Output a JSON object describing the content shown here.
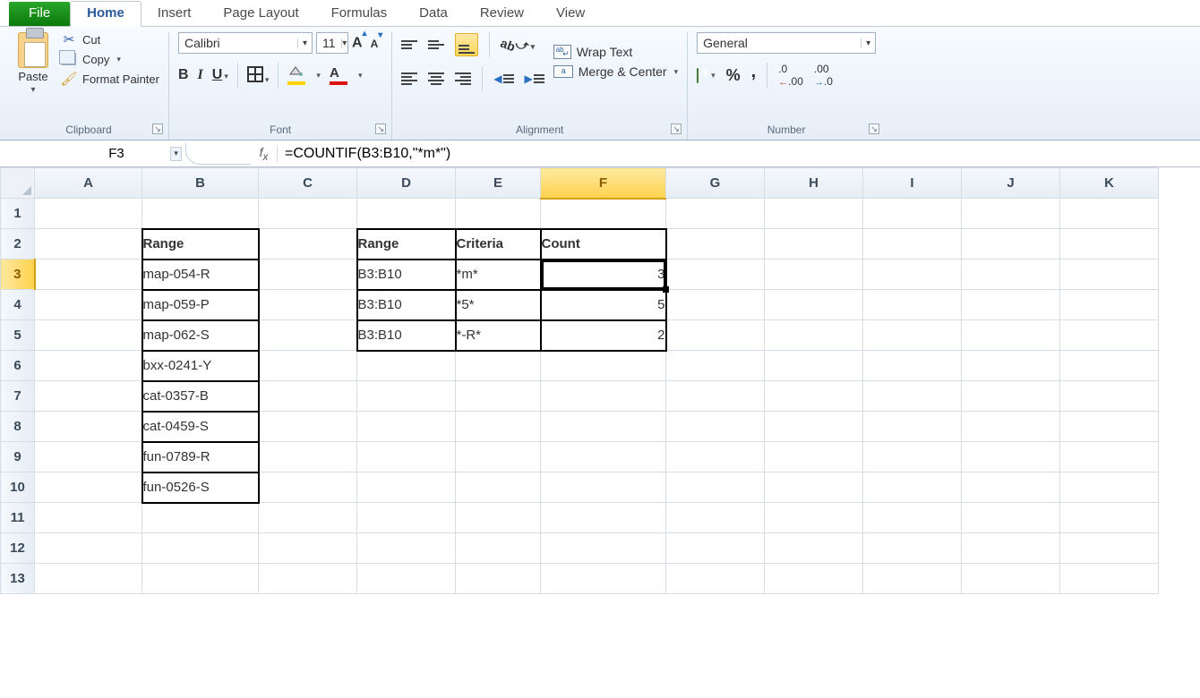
{
  "tabs": {
    "file": "File",
    "home": "Home",
    "insert": "Insert",
    "page_layout": "Page Layout",
    "formulas": "Formulas",
    "data": "Data",
    "review": "Review",
    "view": "View"
  },
  "ribbon": {
    "clipboard": {
      "label": "Clipboard",
      "paste": "Paste",
      "cut": "Cut",
      "copy": "Copy",
      "format_painter": "Format Painter"
    },
    "font": {
      "label": "Font",
      "name": "Calibri",
      "size": "11"
    },
    "alignment": {
      "label": "Alignment",
      "wrap": "Wrap Text",
      "merge": "Merge & Center"
    },
    "number": {
      "label": "Number",
      "format": "General"
    }
  },
  "formula_bar": {
    "namebox": "F3",
    "formula": "=COUNTIF(B3:B10,\"*m*\")"
  },
  "columns": [
    "A",
    "B",
    "C",
    "D",
    "E",
    "F",
    "G",
    "H",
    "I",
    "J",
    "K"
  ],
  "rows": [
    "1",
    "2",
    "3",
    "4",
    "5",
    "6",
    "7",
    "8",
    "9",
    "10",
    "11",
    "12",
    "13"
  ],
  "selected": {
    "col": "F",
    "row": "3"
  },
  "cells": {
    "B2": "Range",
    "D2": "Range",
    "E2": "Criteria",
    "F2": "Count",
    "B3": "map-054-R",
    "D3": "B3:B10",
    "E3": "*m*",
    "F3": "3",
    "B4": "map-059-P",
    "D4": "B3:B10",
    "E4": "*5*",
    "F4": "5",
    "B5": "map-062-S",
    "D5": "B3:B10",
    "E5": "*-R*",
    "F5": "2",
    "B6": "bxx-0241-Y",
    "B7": "cat-0357-B",
    "B8": "cat-0459-S",
    "B9": "fun-0789-R",
    "B10": "fun-0526-S"
  }
}
